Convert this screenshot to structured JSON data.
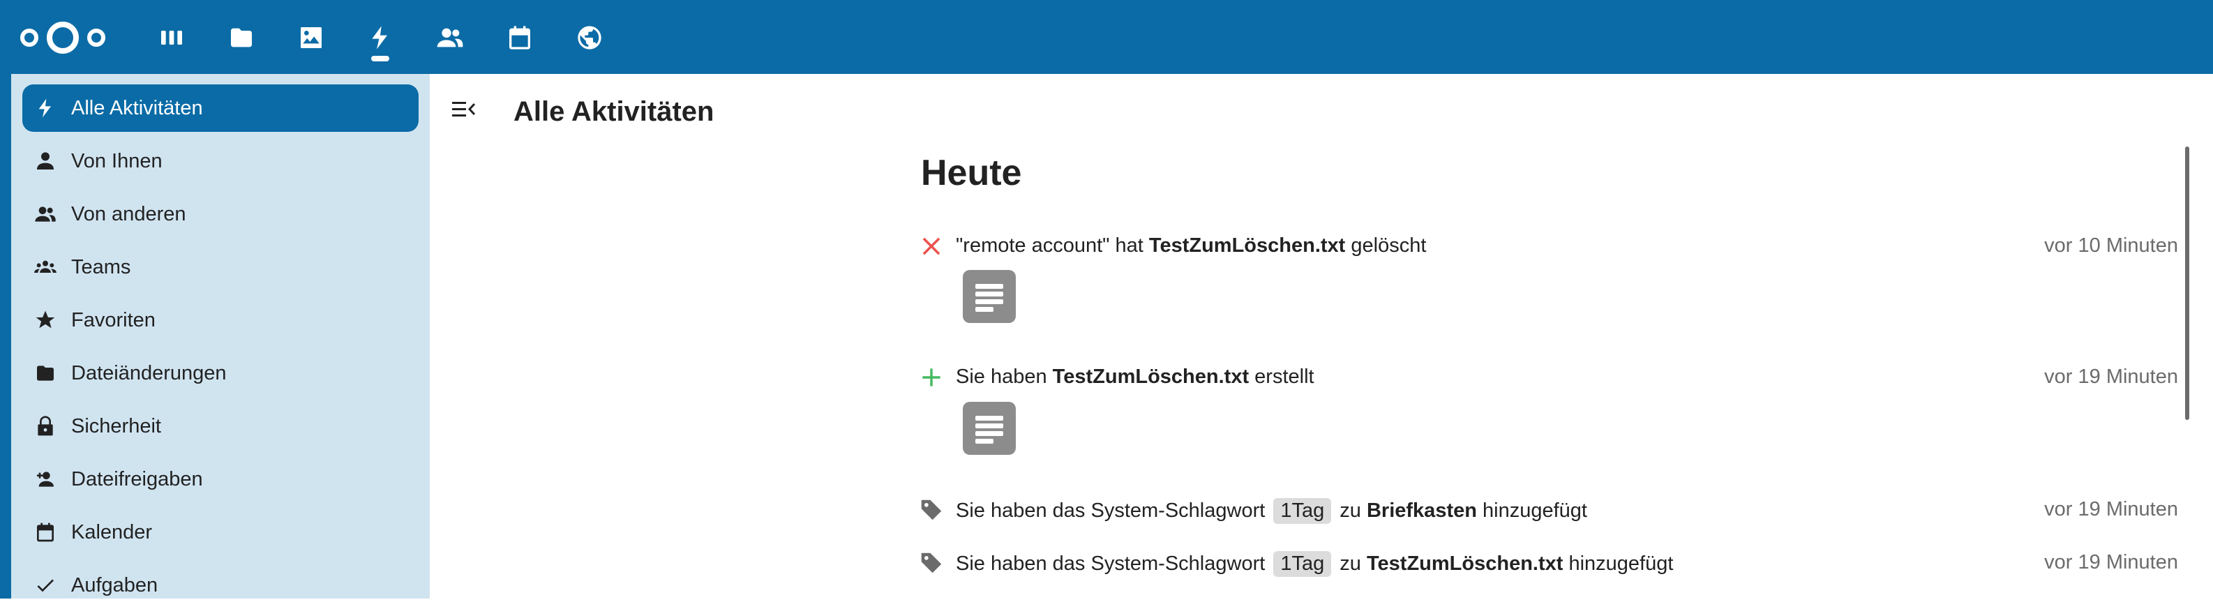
{
  "header": {
    "apps": [
      {
        "name": "dashboard",
        "icon": "dashboard-icon"
      },
      {
        "name": "files",
        "icon": "folder-icon"
      },
      {
        "name": "photos",
        "icon": "image-icon"
      },
      {
        "name": "activity",
        "icon": "lightning-icon"
      },
      {
        "name": "contacts",
        "icon": "contacts-icon"
      },
      {
        "name": "calendar",
        "icon": "calendar-icon"
      },
      {
        "name": "web",
        "icon": "globe-icon"
      }
    ],
    "accent": "#0b6ba6"
  },
  "sidebar": {
    "items": [
      {
        "label": "Alle Aktivitäten",
        "icon": "lightning-icon",
        "active": true
      },
      {
        "label": "Von Ihnen",
        "icon": "person-icon"
      },
      {
        "label": "Von anderen",
        "icon": "people-icon"
      },
      {
        "label": "Teams",
        "icon": "team-icon"
      },
      {
        "label": "Favoriten",
        "icon": "star-icon"
      },
      {
        "label": "Dateiänderungen",
        "icon": "folder-icon"
      },
      {
        "label": "Sicherheit",
        "icon": "lock-icon"
      },
      {
        "label": "Dateifreigaben",
        "icon": "person-add-icon"
      },
      {
        "label": "Kalender",
        "icon": "calendar-icon"
      },
      {
        "label": "Aufgaben",
        "icon": "check-icon"
      }
    ]
  },
  "main": {
    "title": "Alle Aktivitäten",
    "section": "Heute",
    "activities": [
      {
        "icon": "close-icon",
        "pre": "\"remote account\" hat ",
        "bold": "TestZumLöschen.txt",
        "post": " gelöscht",
        "time": "vor 10 Minuten",
        "has_preview": true
      },
      {
        "icon": "plus-icon",
        "pre": "Sie haben ",
        "bold": "TestZumLöschen.txt",
        "post": " erstellt",
        "time": "vor 19 Minuten",
        "has_preview": true
      },
      {
        "icon": "tag-icon",
        "pre": "Sie haben das System-Schlagwort ",
        "tag": "1Tag",
        "mid": " zu ",
        "bold": "Briefkasten",
        "post": " hinzugefügt",
        "time": "vor 19 Minuten"
      },
      {
        "icon": "tag-icon",
        "pre": "Sie haben das System-Schlagwort ",
        "tag": "1Tag",
        "mid": " zu ",
        "bold": "TestZumLöschen.txt",
        "post": " hinzugefügt",
        "time": "vor 19 Minuten"
      }
    ]
  }
}
